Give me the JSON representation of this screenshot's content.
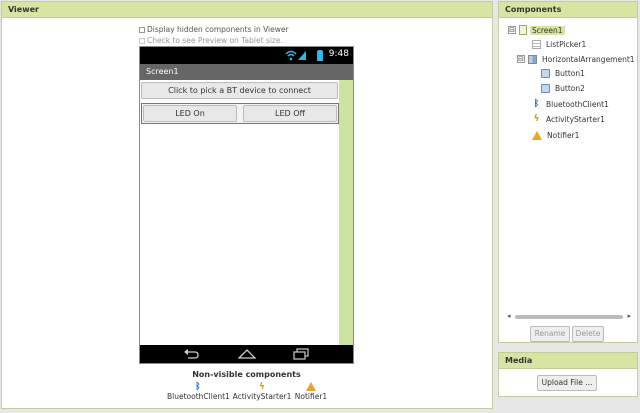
{
  "viewer": {
    "title": "Viewer",
    "display_hidden_label": "Display hidden components in Viewer",
    "tablet_preview_label": "Check to see Preview on Tablet size.",
    "phone": {
      "time": "9:48",
      "screen_title": "Screen1",
      "listpicker_text": "Click to pick a BT device to connect",
      "button1_text": "LED On",
      "button2_text": "LED Off"
    },
    "nonvisible_title": "Non-visible components",
    "nonvisible_items": [
      {
        "label": "BluetoothClient1",
        "icon": "bluetooth-icon"
      },
      {
        "label": "ActivityStarter1",
        "icon": "activity-starter-icon"
      },
      {
        "label": "Notifier1",
        "icon": "warning-icon"
      }
    ]
  },
  "components": {
    "title": "Components",
    "tree": [
      {
        "label": "Screen1",
        "icon": "screen-icon",
        "toggle": "⊟"
      },
      {
        "label": "ListPicker1",
        "icon": "listpicker-icon"
      },
      {
        "label": "HorizontalArrangement1",
        "icon": "horizontal-arrangement-icon",
        "toggle": "⊟"
      },
      {
        "label": "Button1",
        "icon": "button-icon"
      },
      {
        "label": "Button2",
        "icon": "button-icon"
      },
      {
        "label": "BluetoothClient1",
        "icon": "bluetooth-icon"
      },
      {
        "label": "ActivityStarter1",
        "icon": "activity-starter-icon"
      },
      {
        "label": "Notifier1",
        "icon": "warning-icon"
      }
    ],
    "rename_label": "Rename",
    "delete_label": "Delete"
  },
  "media": {
    "title": "Media",
    "upload_label": "Upload File ..."
  },
  "colors": {
    "panel_header": "#d7e5a3",
    "accent_green": "#cde3a0"
  }
}
